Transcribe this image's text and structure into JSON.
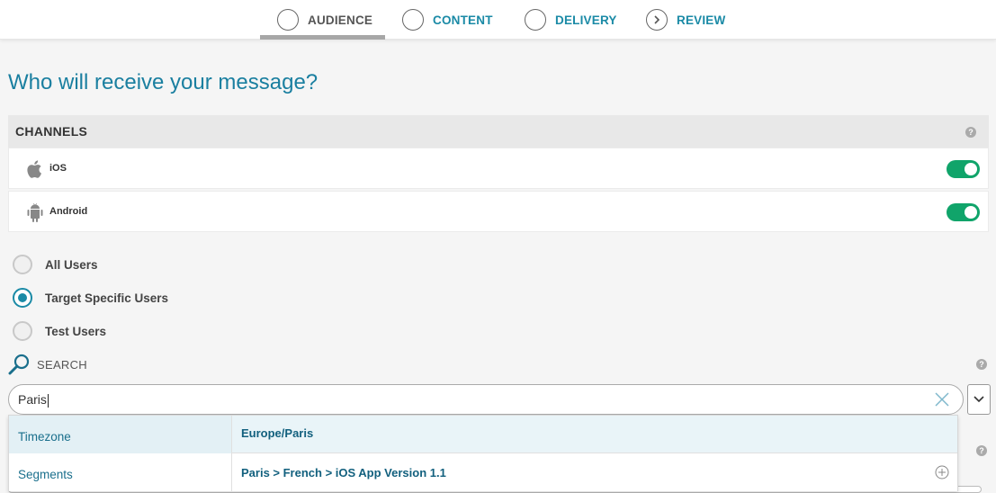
{
  "steps": [
    {
      "label": "AUDIENCE"
    },
    {
      "label": "CONTENT"
    },
    {
      "label": "DELIVERY"
    },
    {
      "label": "REVIEW"
    }
  ],
  "page_title": "Who will receive your message?",
  "channels": {
    "title": "CHANNELS",
    "items": [
      {
        "label": "iOS",
        "icon": "apple-icon",
        "enabled": true
      },
      {
        "label": "Android",
        "icon": "android-icon",
        "enabled": true
      }
    ]
  },
  "audience_options": [
    {
      "label": "All Users",
      "selected": false
    },
    {
      "label": "Target Specific Users",
      "selected": true
    },
    {
      "label": "Test Users",
      "selected": false
    }
  ],
  "search": {
    "label": "SEARCH",
    "value": "Paris"
  },
  "suggestions": [
    {
      "category": "Timezone",
      "value": "Europe/Paris"
    },
    {
      "category": "Segments",
      "value": "Paris > French > iOS App Version 1.1"
    }
  ],
  "colors": {
    "accent": "#1a8aa6",
    "toggle_on": "#10a46a"
  }
}
